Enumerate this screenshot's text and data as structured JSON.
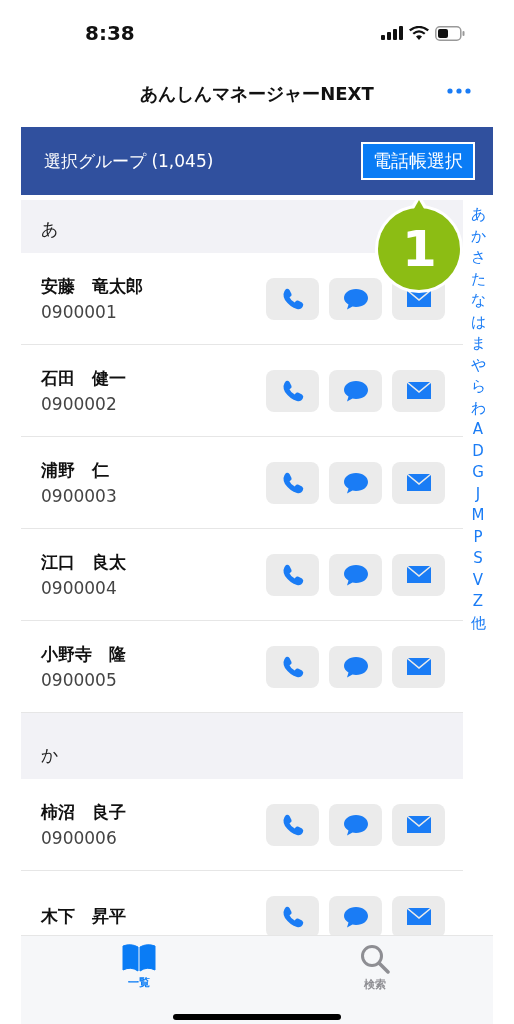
{
  "status_bar": {
    "time": "8:38"
  },
  "nav": {
    "title": "あんしんマネージャーNEXT"
  },
  "group_bar": {
    "label": "選択グループ (1,045)",
    "button": "電話帳選択"
  },
  "sections": [
    {
      "heading": "あ",
      "contacts": [
        {
          "name": "安藤　竜太郎",
          "number": "0900001"
        },
        {
          "name": "石田　健一",
          "number": "0900002"
        },
        {
          "name": "浦野　仁",
          "number": "0900003"
        },
        {
          "name": "江口　良太",
          "number": "0900004"
        },
        {
          "name": "小野寺　隆",
          "number": "0900005"
        }
      ]
    },
    {
      "heading": "か",
      "contacts": [
        {
          "name": "柿沼　良子",
          "number": "0900006"
        },
        {
          "name": "木下　昇平"
        }
      ]
    }
  ],
  "index": [
    "あ",
    "か",
    "さ",
    "た",
    "な",
    "は",
    "ま",
    "や",
    "ら",
    "わ",
    "A",
    "D",
    "G",
    "J",
    "M",
    "P",
    "S",
    "V",
    "Z",
    "他"
  ],
  "callout": {
    "label": "1"
  },
  "tabs": [
    {
      "kind": "list",
      "label": "一覧",
      "selected": true
    },
    {
      "kind": "search",
      "label": "検索",
      "selected": false
    }
  ]
}
